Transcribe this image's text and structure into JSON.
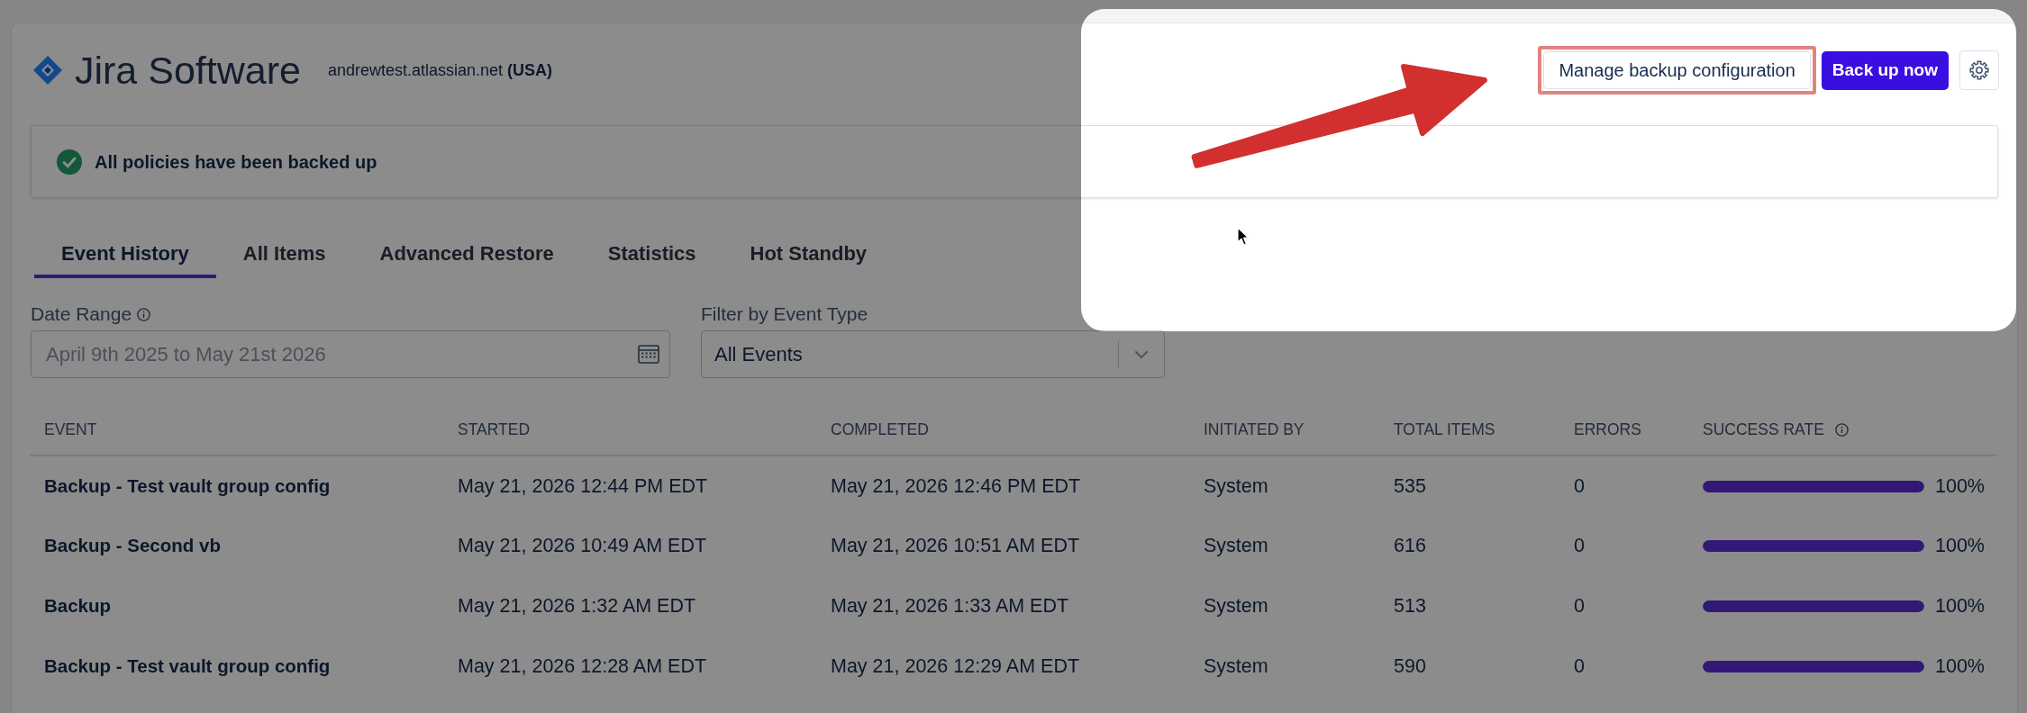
{
  "header": {
    "product": "Jira Software",
    "site": "andrewtest.atlassian.net **(USA)**",
    "buttons": [
      {
        "kind": "secondary",
        "label": "Manage backup configuration",
        "highlighted": true
      },
      {
        "kind": "primary",
        "label": "Back up now",
        "highlighted": false
      },
      {
        "kind": "settings",
        "highlighted": false
      }
    ]
  },
  "banner": {
    "kind": "success",
    "text": "All policies have been backed up"
  },
  "tabs": [
    {
      "label": "Event History",
      "selected": true
    },
    {
      "label": "All Items",
      "selected": false
    },
    {
      "label": "Advanced Restore",
      "selected": false
    },
    {
      "label": "Statistics",
      "selected": false
    },
    {
      "label": "Hot Standby",
      "selected": false
    }
  ],
  "filters": [
    {
      "kind": "date_range",
      "label": "Date Range",
      "info": true,
      "placeholder": "April 9th 2025 to May 21st 2026"
    },
    {
      "kind": "select",
      "label": "Filter by Event Type",
      "info": false,
      "value": "All Events"
    }
  ],
  "table": {
    "columns": [
      {
        "label": "EVENT",
        "info": false
      },
      {
        "label": "STARTED",
        "info": false
      },
      {
        "label": "COMPLETED",
        "info": false
      },
      {
        "label": "INITIATED BY",
        "info": false
      },
      {
        "label": "TOTAL ITEMS",
        "info": false
      },
      {
        "label": "ERRORS",
        "info": false
      },
      {
        "label": "SUCCESS RATE",
        "info": true
      }
    ],
    "rows": [
      {
        "event": "Backup - Test vault group config",
        "started": "May 21, 2026 12:44 PM EDT",
        "completed": "May 21, 2026 12:46 PM EDT",
        "initiated_by": "System",
        "total_items": "535",
        "errors": "0",
        "level": 1,
        "success_rate": "100%"
      },
      {
        "event": "Backup - Second vb",
        "started": "May 21, 2026 10:49 AM EDT",
        "completed": "May 21, 2026 10:51 AM EDT",
        "initiated_by": "System",
        "total_items": "616",
        "errors": "0",
        "level": 1,
        "success_rate": "100%"
      },
      {
        "event": "Backup",
        "started": "May 21, 2026 1:32 AM EDT",
        "completed": "May 21, 2026 1:33 AM EDT",
        "initiated_by": "System",
        "total_items": "513",
        "errors": "0",
        "level": 1,
        "success_rate": "100%"
      },
      {
        "event": "Backup - Test vault group config",
        "started": "May 21, 2026 12:28 AM EDT",
        "completed": "May 21, 2026 12:29 AM EDT",
        "initiated_by": "System",
        "total_items": "590",
        "errors": "0",
        "level": 1,
        "success_rate": "100%"
      }
    ]
  }
}
